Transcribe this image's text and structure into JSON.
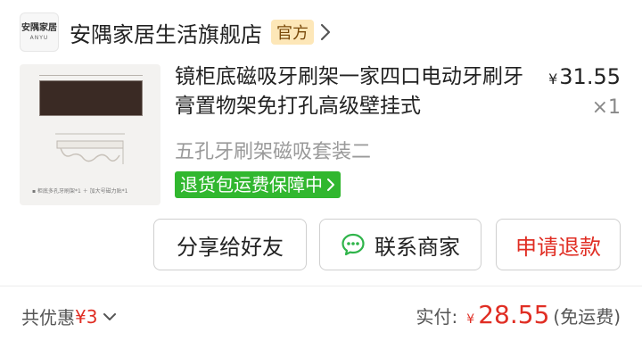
{
  "store": {
    "logo_text": "安隅家居",
    "logo_sub": "ANYU",
    "name": "安隅家居生活旗舰店",
    "badge": "官方"
  },
  "product": {
    "title": "镜柜底磁吸牙刷架一家四口电动牙刷牙膏置物架免打孔高级壁挂式",
    "image_caption": "▪ 柜底多孔牙刷架*1 ＋ 加大号磁力贴*1",
    "price_symbol": "¥",
    "price": "31.55",
    "quantity": "×1",
    "spec": "五孔牙刷架磁吸套装二",
    "guarantee": "退货包运费保障中"
  },
  "actions": {
    "share": "分享给好友",
    "contact": "联系商家",
    "refund": "申请退款"
  },
  "summary": {
    "discount_label": "共优惠",
    "discount_amount": "¥3",
    "paid_label": "实付:",
    "paid_symbol": "¥",
    "paid_amount": "28.55",
    "shipping_note": "(免运费)"
  },
  "colors": {
    "accent_red": "#e02e24",
    "guarantee_green": "#31b72f",
    "official_badge_bg": "#fde7b8",
    "chat_icon_green": "#2fb44a"
  },
  "icons": {
    "store_chevron": "chevron-right-icon",
    "guarantee_chevron": "chevron-right-icon",
    "contact": "chat-bubble-icon",
    "discount_toggle": "chevron-down-icon"
  }
}
